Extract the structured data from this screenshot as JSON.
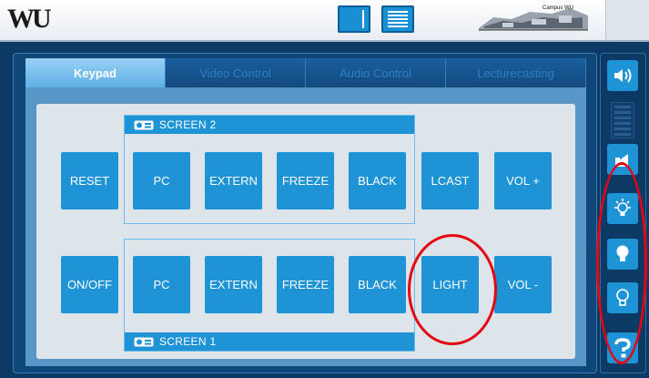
{
  "header": {
    "logo": "WU",
    "campus_label": "Campus WU"
  },
  "tabs": [
    {
      "label": "Keypad",
      "active": true
    },
    {
      "label": "Video Control",
      "active": false
    },
    {
      "label": "Audio Control",
      "active": false
    },
    {
      "label": "Lecturecasting",
      "active": false
    }
  ],
  "groups": {
    "screen2": {
      "label": "SCREEN 2"
    },
    "screen1": {
      "label": "SCREEN 1"
    }
  },
  "keys": {
    "reset": "RESET",
    "pc_top": "PC",
    "extern_top": "EXTERN",
    "freeze_top": "FREEZE",
    "black_top": "BLACK",
    "lcast": "LCAST",
    "vol_up": "VOL +",
    "onoff": "ON/OFF",
    "pc_bottom": "PC",
    "extern_bottom": "EXTERN",
    "freeze_bottom": "FREEZE",
    "black_bottom": "BLACK",
    "light": "LIGHT",
    "vol_down": "VOL -"
  },
  "rail_icons": [
    "speaker-icon",
    "volume-meter-icon",
    "mute-icon",
    "light-on-icon",
    "bulb-filled-icon",
    "bulb-outline-icon",
    "help-icon"
  ],
  "colors": {
    "accent": "#1e93d6",
    "panel": "#0f4778",
    "highlight_ring": "#e30613"
  }
}
